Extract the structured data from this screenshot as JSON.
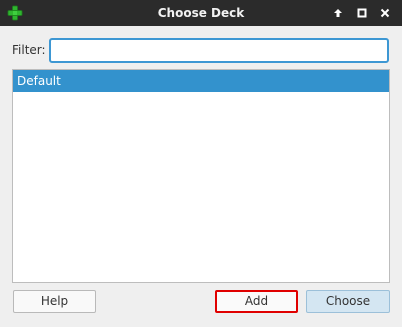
{
  "window": {
    "title": "Choose Deck",
    "app_icon": "green-plus-icon",
    "controls": [
      "keep-above-icon",
      "maximize-icon",
      "close-icon"
    ]
  },
  "filter": {
    "label": "Filter:",
    "value": "",
    "placeholder": ""
  },
  "decks": {
    "items": [
      {
        "label": "Default",
        "selected": true
      }
    ]
  },
  "buttons": {
    "help_label": "Help",
    "add_label": "Add",
    "choose_label": "Choose"
  },
  "colors": {
    "selection": "#3392cd",
    "focus_border": "#3d97d3",
    "highlight_border": "#e00000",
    "default_button": "#d4e6f2",
    "titlebar": "#2b2b2b"
  }
}
